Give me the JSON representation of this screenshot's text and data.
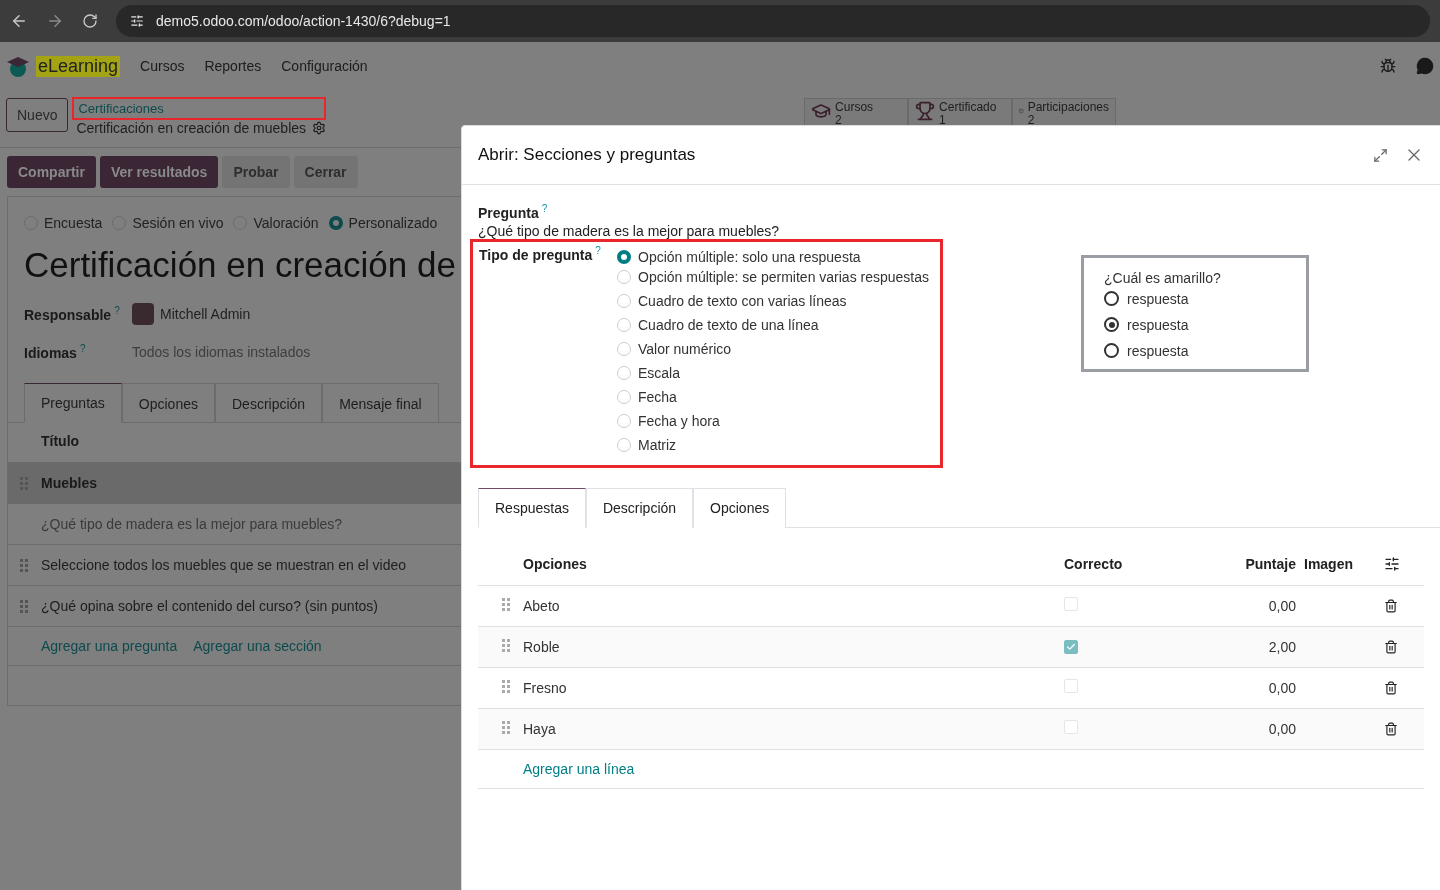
{
  "browser": {
    "url": "demo5.odoo.com/odoo/action-1430/6?debug=1"
  },
  "navbar": {
    "app": "eLearning",
    "menus": [
      "Cursos",
      "Reportes",
      "Configuración"
    ]
  },
  "control_panel": {
    "new_button": "Nuevo",
    "breadcrumb": "Certificaciones",
    "record": "Certificación en creación de muebles",
    "stat_buttons": [
      {
        "label": "Cursos",
        "count": "2",
        "kind": "courses"
      },
      {
        "label": "Certificado",
        "count": "1",
        "kind": "trophy"
      },
      {
        "label": "Participaciones",
        "count": "2",
        "kind": "check"
      }
    ]
  },
  "actions": [
    {
      "label": "Compartir",
      "kind": "primary"
    },
    {
      "label": "Ver resultados",
      "kind": "primary"
    },
    {
      "label": "Probar",
      "kind": "secondary"
    },
    {
      "label": "Cerrar",
      "kind": "secondary"
    }
  ],
  "form": {
    "survey_types": [
      {
        "label": "Encuesta",
        "selected": false
      },
      {
        "label": "Sesión en vivo",
        "selected": false
      },
      {
        "label": "Valoración",
        "selected": false
      },
      {
        "label": "Personalizado",
        "selected": true
      }
    ],
    "title": "Certificación en creación de",
    "fields": [
      {
        "label": "Responsable",
        "help": "?",
        "value": "Mitchell Admin",
        "kind": "user"
      },
      {
        "label": "Idiomas",
        "help": "?",
        "value": "Todos los idiomas instalados",
        "kind": "placeholder"
      }
    ],
    "tabs": [
      {
        "label": "Preguntas",
        "selected": true
      },
      {
        "label": "Opciones",
        "selected": false
      },
      {
        "label": "Descripción",
        "selected": false
      },
      {
        "label": "Mensaje final",
        "selected": false
      }
    ],
    "list_header": "Título",
    "rows": [
      {
        "title": "Muebles",
        "kind": "section",
        "handle": true
      },
      {
        "title": "¿Qué tipo de madera es la mejor para muebles?",
        "kind": "question",
        "handle": false
      },
      {
        "title": "Seleccione todos los muebles que se muestran en el video",
        "kind": "question",
        "handle": true
      },
      {
        "title": "¿Qué opina sobre el contenido del curso? (sin puntos)",
        "kind": "question",
        "handle": true
      }
    ],
    "add_links": [
      "Agregar una pregunta",
      "Agregar una sección"
    ]
  },
  "dialog": {
    "title": "Abrir: Secciones y preguntas",
    "question_label": "Pregunta",
    "question_help": "?",
    "question": "¿Qué tipo de madera es la mejor para muebles?",
    "type_label": "Tipo de pregunta",
    "type_help": "?",
    "types": [
      {
        "label": "Opción múltiple: solo una respuesta",
        "selected": true
      },
      {
        "label": "Opción múltiple: se permiten varias respuestas",
        "selected": false
      },
      {
        "label": "Cuadro de texto con varias líneas",
        "selected": false
      },
      {
        "label": "Cuadro de texto de una línea",
        "selected": false
      },
      {
        "label": "Valor numérico",
        "selected": false
      },
      {
        "label": "Escala",
        "selected": false
      },
      {
        "label": "Fecha",
        "selected": false
      },
      {
        "label": "Fecha y hora",
        "selected": false
      },
      {
        "label": "Matriz",
        "selected": false
      }
    ],
    "preview": {
      "question": "¿Cuál es amarillo?",
      "answers": [
        {
          "label": "respuesta",
          "selected": false
        },
        {
          "label": "respuesta",
          "selected": true
        },
        {
          "label": "respuesta",
          "selected": false
        }
      ]
    },
    "tabs": [
      {
        "label": "Respuestas",
        "selected": true
      },
      {
        "label": "Descripción",
        "selected": false
      },
      {
        "label": "Opciones",
        "selected": false
      }
    ],
    "columns": [
      "Opciones",
      "Correcto",
      "Puntaje",
      "Imagen"
    ],
    "answers": [
      {
        "name": "Abeto",
        "correct": false,
        "score": "0,00"
      },
      {
        "name": "Roble",
        "correct": true,
        "score": "2,00"
      },
      {
        "name": "Fresno",
        "correct": false,
        "score": "0,00"
      },
      {
        "name": "Haya",
        "correct": false,
        "score": "0,00"
      }
    ],
    "add_line": "Agregar una línea"
  }
}
